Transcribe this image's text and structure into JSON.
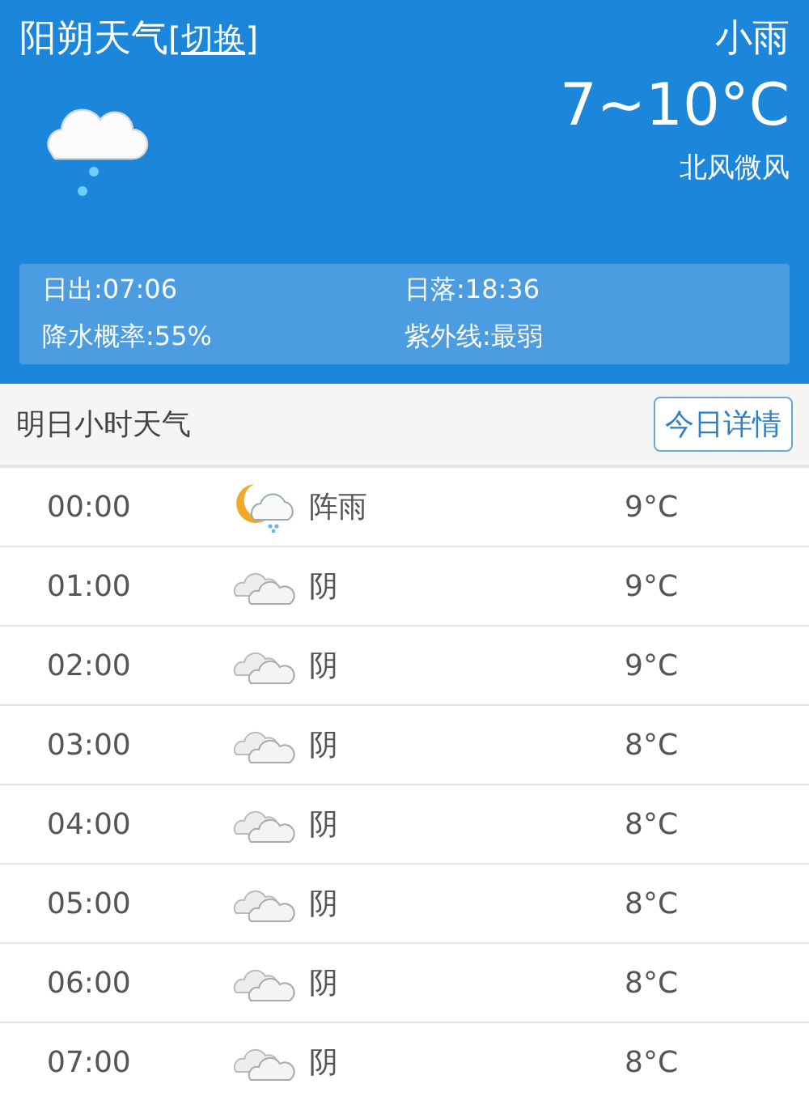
{
  "header": {
    "city": "阳朔天气",
    "switch_link": "[切换]",
    "condition": "小雨",
    "temperature": "7~10°C",
    "wind": "北风微风",
    "kind": "rain"
  },
  "details": [
    {
      "text": "日出:07:06"
    },
    {
      "text": "日落:18:36"
    },
    {
      "text": "降水概率:55%"
    },
    {
      "text": "紫外线:最弱"
    }
  ],
  "section": {
    "title": "明日小时天气",
    "button": "今日详情"
  },
  "hours": [
    {
      "time": "00:00",
      "kind": "shower",
      "condition": "阵雨",
      "temp": "9°C"
    },
    {
      "time": "01:00",
      "kind": "overcast",
      "condition": "阴",
      "temp": "9°C"
    },
    {
      "time": "02:00",
      "kind": "overcast",
      "condition": "阴",
      "temp": "9°C"
    },
    {
      "time": "03:00",
      "kind": "overcast",
      "condition": "阴",
      "temp": "8°C"
    },
    {
      "time": "04:00",
      "kind": "overcast",
      "condition": "阴",
      "temp": "8°C"
    },
    {
      "time": "05:00",
      "kind": "overcast",
      "condition": "阴",
      "temp": "8°C"
    },
    {
      "time": "06:00",
      "kind": "overcast",
      "condition": "阴",
      "temp": "8°C"
    },
    {
      "time": "07:00",
      "kind": "overcast",
      "condition": "阴",
      "temp": "8°C"
    }
  ]
}
